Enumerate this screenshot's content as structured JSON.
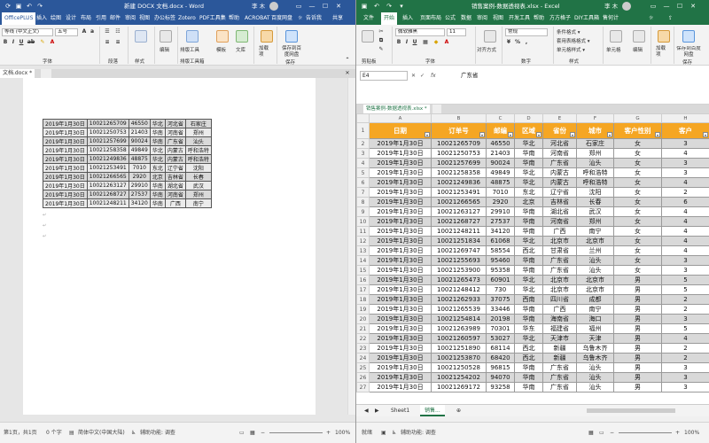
{
  "word": {
    "title": "新建 DOCX 文档.docx - Word",
    "user": "李 木",
    "accent_color": "#2b579a",
    "tabs": [
      "OfficePLUS",
      "插入",
      "绘图",
      "设计",
      "布局",
      "引用",
      "邮件",
      "审阅",
      "视图",
      "办公标签",
      "Zotero",
      "PDF工具集",
      "帮助",
      "ACROBAT",
      "百度网盘"
    ],
    "tell_me": "告诉我",
    "share": "共享",
    "ribbon": {
      "font_name": "等线 (中文正文)",
      "font_size": "五号",
      "font_group": "字体",
      "paragraph_group": "段落",
      "styles_group": "样式",
      "editing_label": "编辑",
      "typeset_label": "排版工具",
      "typeset_group": "排版工具箱",
      "template_label": "模板",
      "library_label": "文库",
      "addin_label": "加载项",
      "save_baidu_label": "保存到百度网盘",
      "save_group": "保存"
    },
    "doc_tab": "文档.docx *",
    "table_rows": [
      [
        "2019年1月30日",
        "10021265709",
        "46550",
        "华北",
        "河北省",
        "石家庄"
      ],
      [
        "2019年1月30日",
        "10021250753",
        "21403",
        "华南",
        "河南省",
        "郑州"
      ],
      [
        "2019年1月30日",
        "10021257699",
        "90024",
        "华南",
        "广东省",
        "汕头"
      ],
      [
        "2019年1月30日",
        "10021258358",
        "49849",
        "华北",
        "内蒙古",
        "呼和浩特"
      ],
      [
        "2019年1月30日",
        "10021249836",
        "48875",
        "华北",
        "内蒙古",
        "呼和浩特"
      ],
      [
        "2019年1月30日",
        "10021253491",
        "7010",
        "东北",
        "辽宁省",
        "沈阳"
      ],
      [
        "2019年1月30日",
        "10021266565",
        "2920",
        "北京",
        "吉林省",
        "长春"
      ],
      [
        "2019年1月30日",
        "10021263127",
        "29910",
        "华南",
        "湖北省",
        "武汉"
      ],
      [
        "2019年1月30日",
        "10021268727",
        "27537",
        "华南",
        "河南省",
        "郑州"
      ],
      [
        "2019年1月30日",
        "10021248211",
        "34120",
        "华南",
        "广西",
        "南宁"
      ]
    ],
    "status": {
      "page": "第1页，共1页",
      "words": "0 个字",
      "language": "简体中文(中国大陆)",
      "accessibility": "辅助功能: 调查",
      "zoom": "100%"
    }
  },
  "excel": {
    "title": "销售案例-数据透视表.xlsx - Excel",
    "user": "李 木",
    "accent_color": "#217346",
    "tabs": [
      "文件",
      "开始",
      "插入",
      "页面布局",
      "公式",
      "数据",
      "审阅",
      "视图",
      "开发工具",
      "帮助",
      "方方格子",
      "DIY工具箱",
      "售何计"
    ],
    "ribbon": {
      "font_name": "微软雅黑",
      "font_size": "11",
      "font_group": "字体",
      "clipboard_group": "剪贴板",
      "align_label": "对齐方式",
      "number_format": "常规",
      "number_group": "数字",
      "cond_format": "条件格式 ▾",
      "table_format": "套用表格格式 ▾",
      "cell_style": "单元格样式 ▾",
      "styles_group": "样式",
      "cells_label": "单元格",
      "editing_label": "编辑",
      "addin_label": "加载项",
      "save_baidu_label": "保存到百度网盘",
      "save_group": "保存"
    },
    "name_box": "E4",
    "formula": "广东省",
    "workbook_tab": "销售案例-数据透视表.xlsx *",
    "columns": [
      "A",
      "B",
      "C",
      "D",
      "E",
      "F",
      "G",
      "H"
    ],
    "headers": [
      "日期",
      "订单号",
      "邮编",
      "区域",
      "省份",
      "城市",
      "客户性别",
      "客户"
    ],
    "rows": [
      [
        "2019年1月30日",
        "10021265709",
        "46550",
        "华北",
        "河北省",
        "石家庄",
        "女",
        "3"
      ],
      [
        "2019年1月30日",
        "10021250753",
        "21403",
        "华南",
        "河南省",
        "郑州",
        "女",
        "4"
      ],
      [
        "2019年1月30日",
        "10021257699",
        "90024",
        "华南",
        "广东省",
        "汕头",
        "女",
        "3"
      ],
      [
        "2019年1月30日",
        "10021258358",
        "49849",
        "华北",
        "内蒙古",
        "呼和浩特",
        "女",
        "3"
      ],
      [
        "2019年1月30日",
        "10021249836",
        "48875",
        "华北",
        "内蒙古",
        "呼和浩特",
        "女",
        "4"
      ],
      [
        "2019年1月30日",
        "10021253491",
        "7010",
        "东北",
        "辽宁省",
        "沈阳",
        "女",
        "2"
      ],
      [
        "2019年1月30日",
        "10021266565",
        "2920",
        "北京",
        "吉林省",
        "长春",
        "女",
        "6"
      ],
      [
        "2019年1月30日",
        "10021263127",
        "29910",
        "华南",
        "湖北省",
        "武汉",
        "女",
        "4"
      ],
      [
        "2019年1月30日",
        "10021268727",
        "27537",
        "华南",
        "河南省",
        "郑州",
        "女",
        "4"
      ],
      [
        "2019年1月30日",
        "10021248211",
        "34120",
        "华南",
        "广西",
        "南宁",
        "女",
        "4"
      ],
      [
        "2019年1月30日",
        "10021251834",
        "61068",
        "华北",
        "北京市",
        "北京市",
        "女",
        "4"
      ],
      [
        "2019年1月30日",
        "10021269747",
        "58554",
        "西北",
        "甘肃省",
        "兰州",
        "女",
        "4"
      ],
      [
        "2019年1月30日",
        "10021255693",
        "95460",
        "华南",
        "广东省",
        "汕头",
        "女",
        "3"
      ],
      [
        "2019年1月30日",
        "10021253900",
        "95358",
        "华南",
        "广东省",
        "汕头",
        "女",
        "3"
      ],
      [
        "2019年1月30日",
        "10021265473",
        "60901",
        "华北",
        "北京市",
        "北京市",
        "男",
        "5"
      ],
      [
        "2019年1月30日",
        "10021248412",
        "730",
        "华北",
        "北京市",
        "北京市",
        "男",
        "5"
      ],
      [
        "2019年1月30日",
        "10021262933",
        "37075",
        "西南",
        "四川省",
        "成都",
        "男",
        "2"
      ],
      [
        "2019年1月30日",
        "10021265539",
        "33446",
        "华南",
        "广西",
        "南宁",
        "男",
        "2"
      ],
      [
        "2019年1月30日",
        "10021254814",
        "20198",
        "华南",
        "海南省",
        "海口",
        "男",
        "3"
      ],
      [
        "2019年1月30日",
        "10021263989",
        "70301",
        "华东",
        "福建省",
        "福州",
        "男",
        "5"
      ],
      [
        "2019年1月30日",
        "10021260597",
        "53027",
        "华北",
        "天津市",
        "天津",
        "男",
        "4"
      ],
      [
        "2019年1月30日",
        "10021251890",
        "68114",
        "西北",
        "新疆",
        "乌鲁木齐",
        "男",
        "2"
      ],
      [
        "2019年1月30日",
        "10021253870",
        "68420",
        "西北",
        "新疆",
        "乌鲁木齐",
        "男",
        "2"
      ],
      [
        "2019年1月30日",
        "10021250528",
        "96815",
        "华南",
        "广东省",
        "汕头",
        "男",
        "3"
      ],
      [
        "2019年1月30日",
        "10021254202",
        "94070",
        "华南",
        "广东省",
        "汕头",
        "男",
        "3"
      ],
      [
        "2019年1月30日",
        "10021269172",
        "93258",
        "华南",
        "广东省",
        "汕头",
        "男",
        "3"
      ]
    ],
    "sheet_tabs": [
      "Sheet1",
      "销售..."
    ],
    "status": {
      "ready": "就绪",
      "accessibility": "辅助功能: 调查",
      "zoom": "100%"
    }
  }
}
